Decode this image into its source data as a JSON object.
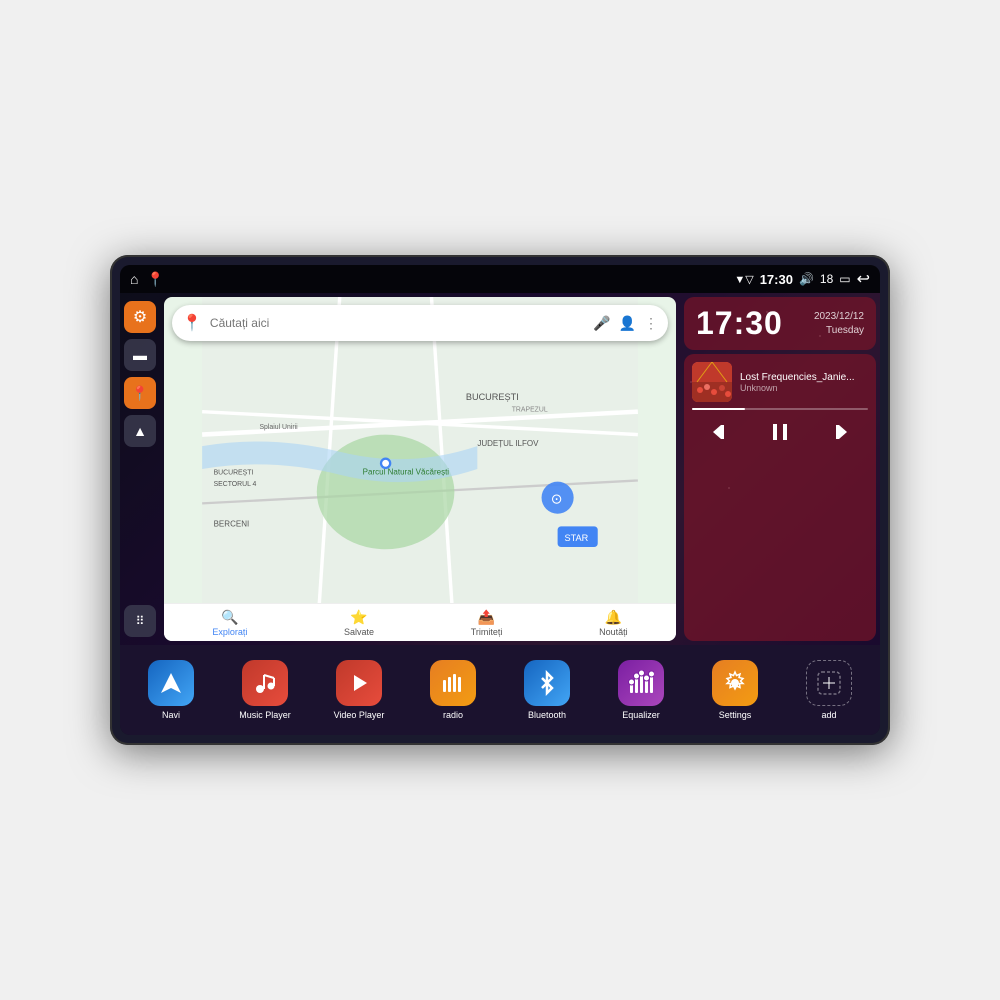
{
  "device": {
    "status_bar": {
      "wifi_icon": "▼",
      "time": "17:30",
      "volume_icon": "🔊",
      "battery_level": "18",
      "battery_icon": "🔋",
      "back_icon": "↩"
    },
    "left_sidebar": {
      "settings_icon": "⚙",
      "files_icon": "📁",
      "maps_icon": "📍",
      "navigation_icon": "▲",
      "apps_icon": "⋮⋮⋮"
    },
    "map": {
      "search_placeholder": "Căutați aici",
      "tabs": [
        {
          "label": "Explorați",
          "icon": "🔍"
        },
        {
          "label": "Salvate",
          "icon": "⭐"
        },
        {
          "label": "Trimiteți",
          "icon": "📤"
        },
        {
          "label": "Noutăți",
          "icon": "🔔"
        }
      ]
    },
    "clock": {
      "time": "17:30",
      "date": "2023/12/12",
      "day": "Tuesday"
    },
    "music": {
      "title": "Lost Frequencies_Janie...",
      "artist": "Unknown",
      "album_art_icon": "🎵"
    },
    "apps": [
      {
        "id": "navi",
        "label": "Navi",
        "icon": "▲",
        "class": "app-navi"
      },
      {
        "id": "music-player",
        "label": "Music Player",
        "icon": "♪",
        "class": "app-music"
      },
      {
        "id": "video-player",
        "label": "Video Player",
        "icon": "▶",
        "class": "app-video"
      },
      {
        "id": "radio",
        "label": "radio",
        "icon": "📻",
        "class": "app-radio"
      },
      {
        "id": "bluetooth",
        "label": "Bluetooth",
        "icon": "⚡",
        "class": "app-bluetooth"
      },
      {
        "id": "equalizer",
        "label": "Equalizer",
        "icon": "🎛",
        "class": "app-equalizer"
      },
      {
        "id": "settings",
        "label": "Settings",
        "icon": "⚙",
        "class": "app-settings"
      },
      {
        "id": "add",
        "label": "add",
        "icon": "+",
        "class": "app-add"
      }
    ]
  }
}
